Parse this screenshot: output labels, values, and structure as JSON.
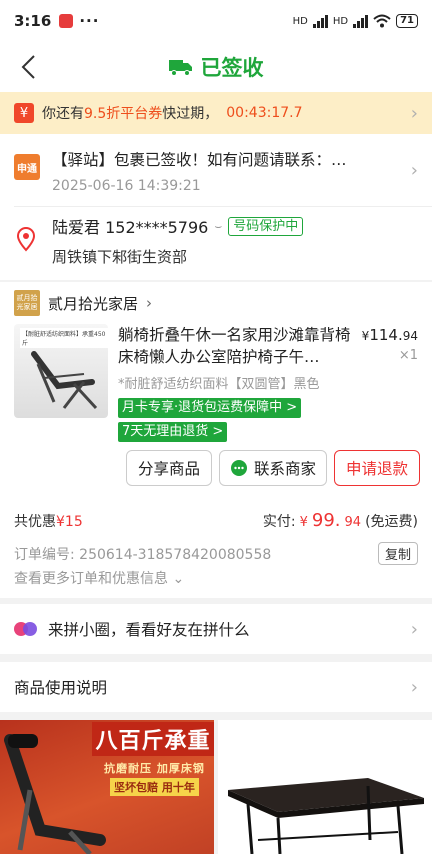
{
  "status_bar": {
    "time": "3:16",
    "dots": "···",
    "battery": "71",
    "signal_label": "HD"
  },
  "header": {
    "title": "已签收",
    "accent_color": "#1fa63b"
  },
  "coupon": {
    "prefix": "你还有",
    "highlight": "9.5折平台券",
    "suffix": "快过期，",
    "countdown": "00:43:17.7"
  },
  "logistics": {
    "courier_icon_text": "申通",
    "message": "【驿站】包裹已签收！如有问题请联系：…",
    "timestamp": "2025-06-16 14:39:21"
  },
  "address": {
    "name_phone": "陆爱君 152****5796",
    "protect_label": "号码保护中",
    "detail": "周铁镇下邾街生资部"
  },
  "shop": {
    "name": "贰月拾光家居",
    "logo_text": "贰月拾光家居"
  },
  "product": {
    "thumb_label": "【耐脏舒适纺织面料】承重450斤",
    "title": "躺椅折叠午休一名家用沙滩靠背椅床椅懒人办公室陪护椅子午…",
    "spec": "*耐脏舒适纺织面料【双圆管】黑色",
    "price_yen": "¥",
    "price_int": "114.",
    "price_dec": "94",
    "qty": "×1",
    "tag1": "月卡专享·退货包运费保障中 >",
    "tag2": "7天无理由退货 >"
  },
  "buttons": {
    "share": "分享商品",
    "contact": "联系商家",
    "refund": "申请退款"
  },
  "summary": {
    "discount_label": "共优惠",
    "discount_value": "¥15",
    "paid_label": "实付:",
    "paid_yen": "¥",
    "paid_int": "99.",
    "paid_dec": "94",
    "shipping": "(免运费)"
  },
  "order": {
    "number_text": "订单编号: 250614-318578420080558",
    "copy_label": "复制",
    "more_label": "查看更多订单和优惠信息"
  },
  "group": {
    "text": "来拼小圈，看看好友在拼什么"
  },
  "usage": {
    "text": "商品使用说明"
  },
  "promo": {
    "headline": "八百斤承重",
    "sub": "抗磨耐压 加厚床钢",
    "tag": "坚坏包赔 用十年"
  }
}
